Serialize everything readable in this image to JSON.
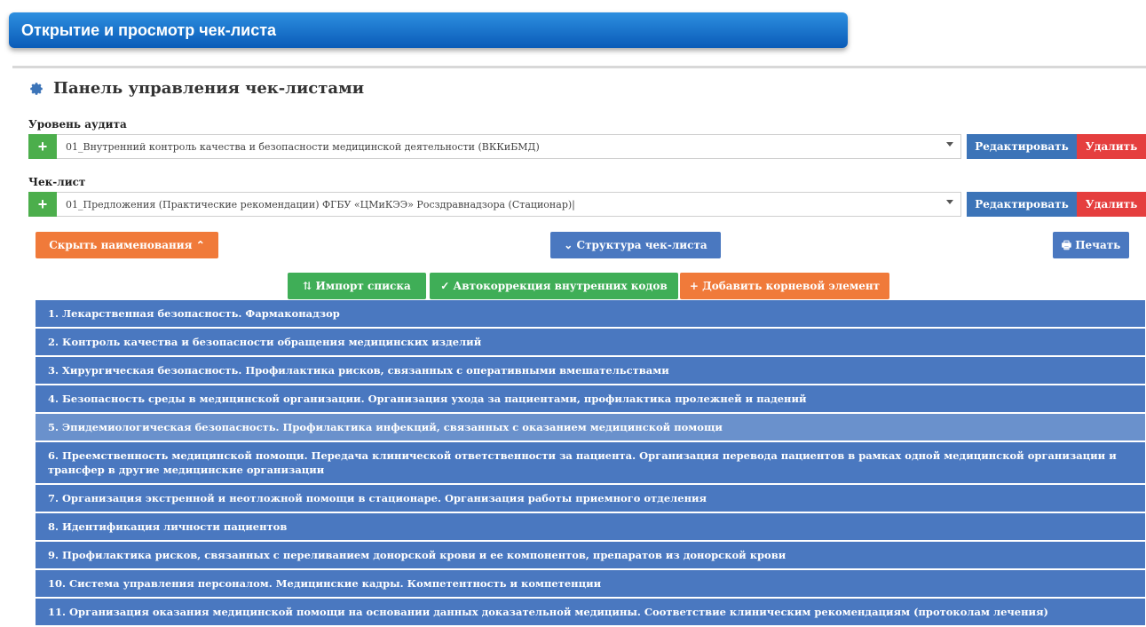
{
  "window_title": "Открытие и просмотр чек-листа",
  "panel_title": "Панель управления чек-листами",
  "audit_level": {
    "label": "Уровень аудита",
    "value": "01_Внутренний контроль качества и безопасности медицинской деятельности (ВККиБМД)",
    "add_label": "+",
    "edit_label": "Редактировать",
    "delete_label": "Удалить"
  },
  "checklist": {
    "label": "Чек-лист",
    "value": "01_Предложения (Практические рекомендации) ФГБУ «ЦМиКЭЭ» Росздравнадзора (Стационар)|",
    "add_label": "+",
    "edit_label": "Редактировать",
    "delete_label": "Удалить"
  },
  "toolbar": {
    "hide_names_label": "Скрыть наименования",
    "hide_names_icon": "chevron-up-icon",
    "structure_label": "Структура чек-листа",
    "structure_icon": "chevron-down-icon",
    "print_label": "Печать",
    "print_icon": "printer-icon",
    "import_label": "Импорт списка",
    "import_icon": "sort-icon",
    "autocorrect_label": "Автокоррекция внутренних кодов",
    "autocorrect_icon": "check-icon",
    "add_root_label": "+ Добавить корневой элемент"
  },
  "colors": {
    "title_bar": "#0a5bb8",
    "green": "#3fae57",
    "blue": "#4a78c0",
    "orange": "#f07a3a",
    "red": "#e53e3e"
  },
  "items": [
    "1. Лекарственная безопасность. Фармаконадзор",
    "2. Контроль качества и безопасности обращения медицинских изделий",
    "3. Хирургическая безопасность. Профилактика рисков, связанных с оперативными вмешательствами",
    "4. Безопасность среды в медицинской организации. Организация ухода за пациентами, профилактика пролежней и падений",
    "5. Эпидемиологическая безопасность. Профилактика инфекций, связанных с оказанием медицинской помощи",
    "6. Преемственность медицинской помощи. Передача клинической ответственности за пациента. Организация перевода пациентов в рамках одной медицинской организации и трансфер в другие медицинские организации",
    "7. Организация экстренной и неотложной помощи в стационаре. Организация работы приемного отделения",
    "8. Идентификация личности пациентов",
    "9. Профилактика рисков, связанных с переливанием донорской крови и ее компонентов, препаратов из донорской крови",
    "10. Система управления персоналом. Медицинские кадры. Компетентность и компетенции",
    "11. Организация оказания медицинской помощи на основании данных доказательной медицины. Соответствие клиническим рекомендациям (протоколам лечения)"
  ]
}
